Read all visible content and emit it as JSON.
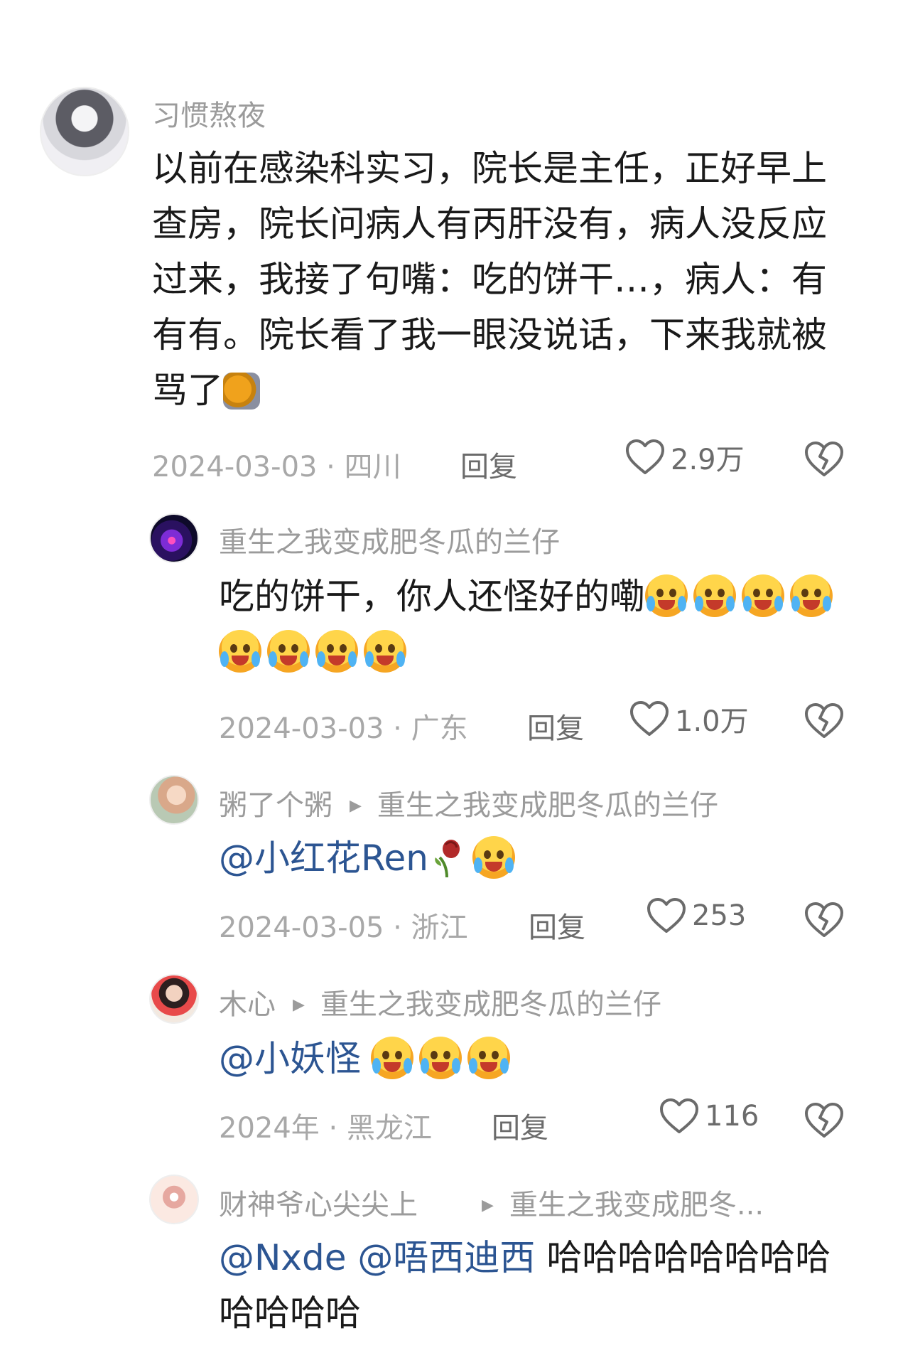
{
  "comments": [
    {
      "username": "习惯熬夜",
      "text": "以前在感染科实习，院长是主任，正好早上查房，院长问病人有丙肝没有，病人没反应过来，我接了句嘴：吃的饼干…，病人：有有有。院长看了我一眼没说话，下来我就被骂了",
      "date": "2024-03-03",
      "location": "四川",
      "reply_label": "回复",
      "likes": "2.9万",
      "avatar_icon": "avatar-image",
      "sticker_icon": "cat-peeking-wall-sticker"
    },
    {
      "username": "重生之我变成肥冬瓜的兰仔",
      "text": "吃的饼干，你人还怪好的嘞",
      "emoji_count": 8,
      "emoji_icon": "laughing-crying-emoji",
      "date": "2024-03-03",
      "location": "广东",
      "reply_label": "回复",
      "likes": "1.0万"
    },
    {
      "username": "粥了个粥",
      "reply_to": "重生之我变成肥冬瓜的兰仔",
      "mention": "@小红花Ren",
      "rose_icon": "wilted-rose-emoji",
      "emoji_icon": "laughing-crying-emoji",
      "date": "2024-03-05",
      "location": "浙江",
      "reply_label": "回复",
      "likes": "253"
    },
    {
      "username": "木心",
      "reply_to": "重生之我变成肥冬瓜的兰仔",
      "mention": "@小妖怪",
      "emoji_count": 3,
      "emoji_icon": "laughing-crying-emoji",
      "date": "2024年",
      "location": "黑龙江",
      "reply_label": "回复",
      "likes": "116"
    },
    {
      "username": "财神爷心尖尖上",
      "reply_to": "重生之我变成肥冬...",
      "mention_1": "@Nxde",
      "mention_2": "@唔西迪西",
      "text": "哈哈哈哈哈哈哈哈哈哈哈哈"
    }
  ],
  "meta_separator": " · ",
  "colors": {
    "username": "#9b9b9b",
    "body_text": "#1a1a1a",
    "mention": "#2c5592",
    "meta": "#a8a8a8",
    "action": "#6b6b6b"
  }
}
